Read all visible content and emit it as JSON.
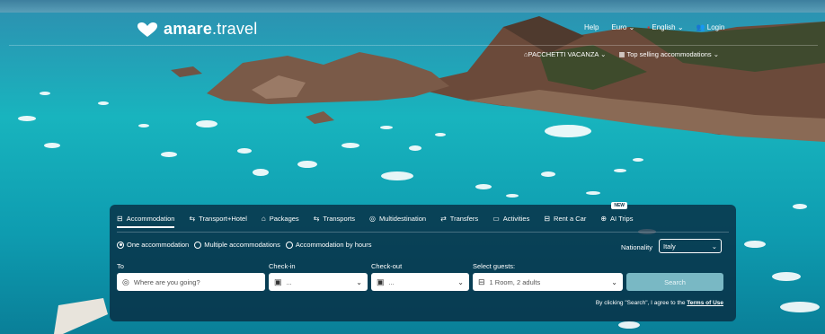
{
  "brand": {
    "name": "amare",
    "tld": ".travel"
  },
  "topnav": {
    "help": "Help",
    "currency": "Euro",
    "language": "English",
    "login": "Login"
  },
  "subnav": {
    "packages": "PACCHETTI VACANZA",
    "top": "Top selling accommodations"
  },
  "tabs": [
    {
      "label": "Accommodation",
      "icon": "bed-icon"
    },
    {
      "label": "Transport+Hotel",
      "icon": "transport-hotel-icon"
    },
    {
      "label": "Packages",
      "icon": "package-icon"
    },
    {
      "label": "Transports",
      "icon": "transport-icon"
    },
    {
      "label": "Multidestination",
      "icon": "pin-icon"
    },
    {
      "label": "Transfers",
      "icon": "transfer-icon"
    },
    {
      "label": "Activities",
      "icon": "ticket-icon"
    },
    {
      "label": "Rent a Car",
      "icon": "car-icon"
    },
    {
      "label": "AI Trips",
      "icon": "ai-icon",
      "badge": "NEW"
    }
  ],
  "options": {
    "one": "One accommodation",
    "multiple": "Multiple accommodations",
    "hours": "Accommodation by hours"
  },
  "nationality": {
    "label": "Nationality",
    "value": "Italy"
  },
  "form": {
    "to_label": "To",
    "to_placeholder": "Where are you going?",
    "checkin_label": "Check-in",
    "checkin_value": "...",
    "checkout_label": "Check-out",
    "checkout_value": "...",
    "guests_label": "Select guests:",
    "guests_value": "1 Room, 2 adults",
    "search": "Search"
  },
  "terms": {
    "text": "By clicking \"Search\", I agree to the",
    "link": "Terms of Use"
  }
}
